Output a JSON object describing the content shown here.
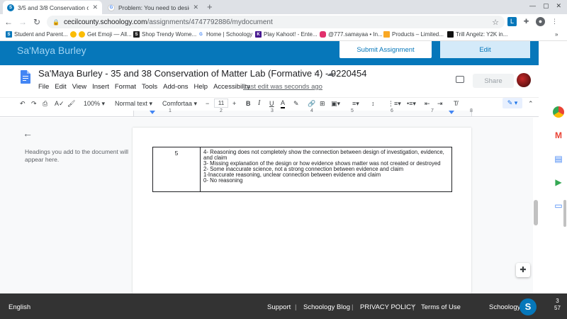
{
  "browser": {
    "tabs": [
      {
        "title": "3/5 and 3/8 Conservation of Ma",
        "active": true
      },
      {
        "title": "Problem: You need to design an",
        "active": false
      }
    ],
    "url_host": "cecilcounty.schoology.com",
    "url_path": "/assignments/4747792886/mydocument",
    "bookmarks": [
      {
        "label": "Student and Parent..."
      },
      {
        "label": "Get Emoji — All..."
      },
      {
        "label": "Shop Trendy Wome..."
      },
      {
        "label": "Home | Schoology"
      },
      {
        "label": "Play Kahoot! - Ente..."
      },
      {
        "label": "@777.samayaa • In..."
      },
      {
        "label": "Products – Limited..."
      },
      {
        "label": "Trill Angelz: Y2K in..."
      }
    ],
    "more_bookmarks": "»"
  },
  "schoology": {
    "student_name": "Sa'Maya Burley",
    "submit_label": "Submit Assignment",
    "edit_label": "Edit"
  },
  "docs": {
    "title": "Sa'Maya Burley - 35 and 38 Conservation of Matter Lab (Formative 4) - 9220454",
    "menus": [
      "File",
      "Edit",
      "View",
      "Insert",
      "Format",
      "Tools",
      "Add-ons",
      "Help",
      "Accessibility"
    ],
    "last_edit": "Last edit was seconds ago",
    "share_label": "Share",
    "toolbar": {
      "zoom": "100%",
      "style": "Normal text",
      "font": "Comfortaa",
      "font_size": "11"
    },
    "ruler_numbers": [
      "1",
      "2",
      "3",
      "4",
      "5",
      "6",
      "7",
      "8"
    ],
    "outline_placeholder": "Headings you add to the document will appear here.",
    "rubric": {
      "score": "5",
      "lines": [
        "4- Reasoning does not completely show the connection between design of investigation, evidence, and claim",
        "3- Missing explanation of the design or how evidence shows matter was not created or destroyed",
        "2- Some inaccurate science, not a strong connection between evidence and claim",
        "1-Inaccurate reasoning, unclear connection between evidence and claim",
        "0- No reasoning"
      ]
    }
  },
  "footer": {
    "language": "English",
    "links": [
      "Support",
      "Schoology Blog",
      "PRIVACY POLICY",
      "Terms of Use"
    ],
    "brand": "Schoology",
    "badge": "S",
    "page_top": "3",
    "page_bottom": "57"
  }
}
